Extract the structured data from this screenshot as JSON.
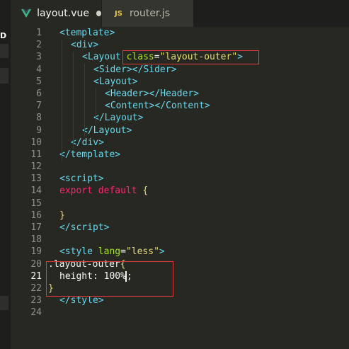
{
  "tabs": [
    {
      "label": "layout.vue",
      "icon": "vue-icon",
      "active": true,
      "dirty": true
    },
    {
      "label": "router.js",
      "icon": "js-icon",
      "icon_text": "JS",
      "active": false
    }
  ],
  "left_strip": {
    "badge": "D"
  },
  "editor": {
    "current_line": 21,
    "lines": [
      {
        "n": "1",
        "tokens": [
          [
            "t-punct",
            "<"
          ],
          [
            "t-tag",
            "template"
          ],
          [
            "t-punct",
            ">"
          ]
        ],
        "indent": 0
      },
      {
        "n": "2",
        "tokens": [
          [
            "t-punct",
            "<"
          ],
          [
            "t-tag",
            "div"
          ],
          [
            "t-punct",
            ">"
          ]
        ],
        "indent": 1
      },
      {
        "n": "3",
        "tokens": [
          [
            "t-punct",
            "<"
          ],
          [
            "t-tag",
            "Layout"
          ],
          [
            "t-white",
            " "
          ],
          [
            "t-attr",
            "class"
          ],
          [
            "t-white",
            "="
          ],
          [
            "t-str",
            "\"layout-outer\""
          ],
          [
            "t-punct",
            ">"
          ]
        ],
        "indent": 2
      },
      {
        "n": "4",
        "tokens": [
          [
            "t-punct",
            "<"
          ],
          [
            "t-tag",
            "Sider"
          ],
          [
            "t-punct",
            "></"
          ],
          [
            "t-tag",
            "Sider"
          ],
          [
            "t-punct",
            ">"
          ]
        ],
        "indent": 3
      },
      {
        "n": "5",
        "tokens": [
          [
            "t-punct",
            "<"
          ],
          [
            "t-tag",
            "Layout"
          ],
          [
            "t-punct",
            ">"
          ]
        ],
        "indent": 3
      },
      {
        "n": "6",
        "tokens": [
          [
            "t-punct",
            "<"
          ],
          [
            "t-tag",
            "Header"
          ],
          [
            "t-punct",
            "></"
          ],
          [
            "t-tag",
            "Header"
          ],
          [
            "t-punct",
            ">"
          ]
        ],
        "indent": 4
      },
      {
        "n": "7",
        "tokens": [
          [
            "t-punct",
            "<"
          ],
          [
            "t-tag",
            "Content"
          ],
          [
            "t-punct",
            "></"
          ],
          [
            "t-tag",
            "Content"
          ],
          [
            "t-punct",
            ">"
          ]
        ],
        "indent": 4
      },
      {
        "n": "8",
        "tokens": [
          [
            "t-punct",
            "</"
          ],
          [
            "t-tag",
            "Layout"
          ],
          [
            "t-punct",
            ">"
          ]
        ],
        "indent": 3
      },
      {
        "n": "9",
        "tokens": [
          [
            "t-punct",
            "</"
          ],
          [
            "t-tag",
            "Layout"
          ],
          [
            "t-punct",
            ">"
          ]
        ],
        "indent": 2
      },
      {
        "n": "10",
        "tokens": [
          [
            "t-punct",
            "</"
          ],
          [
            "t-tag",
            "div"
          ],
          [
            "t-punct",
            ">"
          ]
        ],
        "indent": 1
      },
      {
        "n": "11",
        "tokens": [
          [
            "t-punct",
            "</"
          ],
          [
            "t-tag",
            "template"
          ],
          [
            "t-punct",
            ">"
          ]
        ],
        "indent": 0
      },
      {
        "n": "12",
        "tokens": [],
        "indent": 0
      },
      {
        "n": "13",
        "tokens": [
          [
            "t-punct",
            "<"
          ],
          [
            "t-tag",
            "script"
          ],
          [
            "t-punct",
            ">"
          ]
        ],
        "indent": 0
      },
      {
        "n": "14",
        "tokens": [
          [
            "t-kw",
            "export"
          ],
          [
            "t-white",
            " "
          ],
          [
            "t-kw",
            "default"
          ],
          [
            "t-white",
            " "
          ],
          [
            "t-brace",
            "{"
          ]
        ],
        "indent": 0
      },
      {
        "n": "15",
        "tokens": [],
        "indent": 0
      },
      {
        "n": "16",
        "tokens": [
          [
            "t-brace",
            "}"
          ]
        ],
        "indent": 0
      },
      {
        "n": "17",
        "tokens": [
          [
            "t-punct",
            "</"
          ],
          [
            "t-tag",
            "script"
          ],
          [
            "t-punct",
            ">"
          ]
        ],
        "indent": 0
      },
      {
        "n": "18",
        "tokens": [],
        "indent": 0
      },
      {
        "n": "19",
        "tokens": [
          [
            "t-punct",
            "<"
          ],
          [
            "t-tag",
            "style"
          ],
          [
            "t-white",
            " "
          ],
          [
            "t-attr",
            "lang"
          ],
          [
            "t-white",
            "="
          ],
          [
            "t-str",
            "\"less\""
          ],
          [
            "t-punct",
            ">"
          ]
        ],
        "indent": 0
      },
      {
        "n": "20",
        "tokens": [
          [
            "t-sel",
            ".layout-outer"
          ],
          [
            "t-brace",
            "{"
          ]
        ],
        "indent": 0,
        "shift": -2
      },
      {
        "n": "21",
        "tokens": [
          [
            "t-prop",
            "height"
          ],
          [
            "t-white",
            ": "
          ],
          [
            "t-white",
            "100%"
          ],
          [
            "cursor",
            ""
          ],
          [
            "t-white",
            ";"
          ]
        ],
        "indent": 1,
        "shift": -2
      },
      {
        "n": "22",
        "tokens": [
          [
            "t-brace",
            "}"
          ]
        ],
        "indent": 0,
        "shift": -2
      },
      {
        "n": "23",
        "tokens": [
          [
            "t-punct",
            "</"
          ],
          [
            "t-tag",
            "style"
          ],
          [
            "t-punct",
            ">"
          ]
        ],
        "indent": 0
      },
      {
        "n": "24",
        "tokens": [],
        "indent": 0
      }
    ]
  },
  "colors": {
    "background": "#272822",
    "highlight_box": "#e23a3a",
    "tag": "#66d9ef",
    "attribute": "#a6e22e",
    "string": "#e6db74",
    "keyword": "#f92672"
  }
}
